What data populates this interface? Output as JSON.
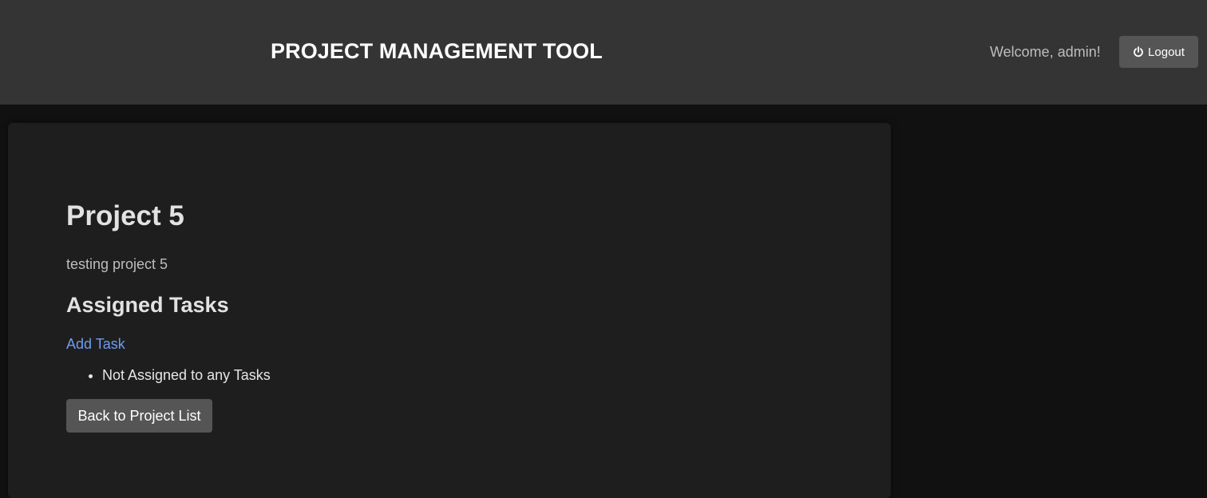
{
  "header": {
    "app_title": "PROJECT MANAGEMENT TOOL",
    "welcome_text": "Welcome, admin!",
    "logout_label": "Logout",
    "logout_icon": "power-icon"
  },
  "project": {
    "title": "Project 5",
    "description": "testing project 5"
  },
  "tasks_section": {
    "title": "Assigned Tasks",
    "add_task_label": "Add Task",
    "items": [
      "Not Assigned to any Tasks"
    ]
  },
  "footer_actions": {
    "back_label": "Back to Project List"
  },
  "colors": {
    "page_background": "#111111",
    "header_background": "#343434",
    "card_background": "#1e1e1e",
    "button_background": "#555555",
    "link": "#6f9cf0"
  }
}
